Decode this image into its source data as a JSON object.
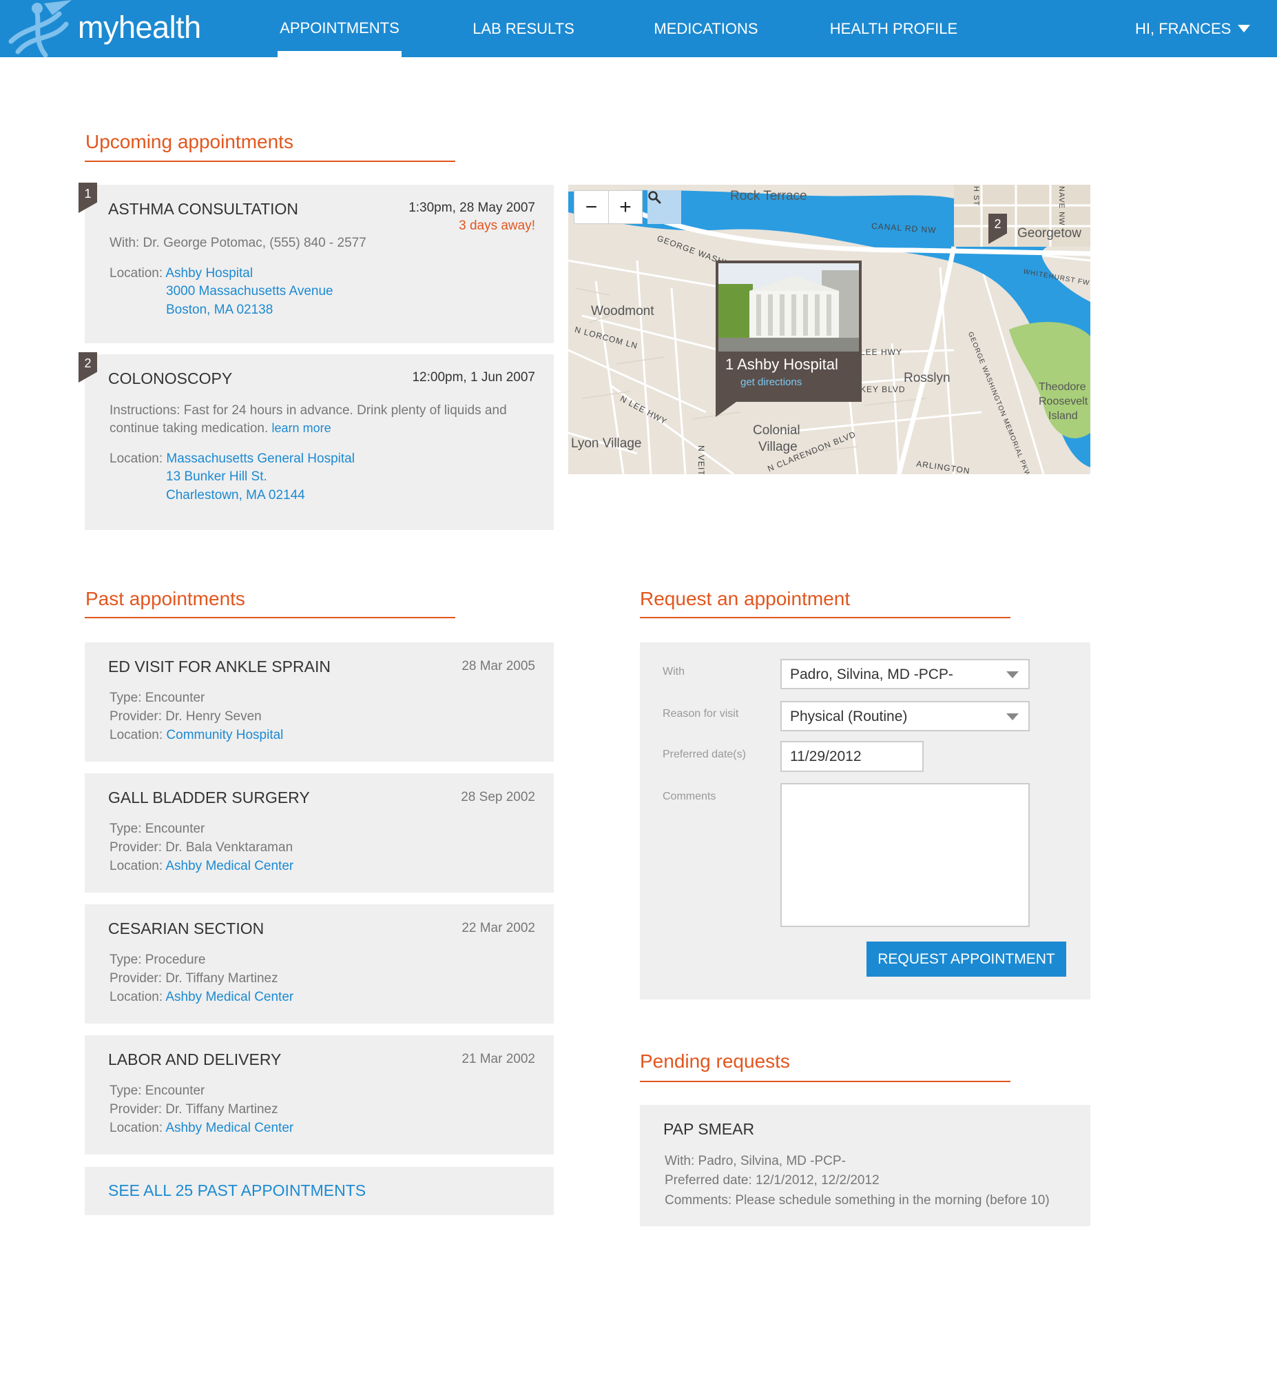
{
  "app": {
    "brand": "myhealth"
  },
  "nav": {
    "items": [
      {
        "label": "APPOINTMENTS",
        "active": true
      },
      {
        "label": "LAB RESULTS"
      },
      {
        "label": "MEDICATIONS"
      },
      {
        "label": "HEALTH PROFILE"
      }
    ],
    "user": "HI, FRANCES"
  },
  "colors": {
    "brand": "#1c8ad2",
    "accent": "#e2561e",
    "card": "#efefef",
    "flag": "#5a4f4a"
  },
  "upcoming": {
    "title": "Upcoming appointments",
    "items": [
      {
        "index": "1",
        "title": "ASTHMA CONSULTATION",
        "time": "1:30pm, 28 May 2007",
        "countdown": "3 days away!",
        "with": "With: Dr. George Potomac, (555) 840 - 2577",
        "location_label": "Location:",
        "location_name": "Ashby Hospital",
        "address1": "3000 Massachusetts Avenue",
        "address2": "Boston, MA 02138"
      },
      {
        "index": "2",
        "title": "COLONOSCOPY",
        "time": "12:00pm, 1 Jun 2007",
        "instructions1": "Instructions: Fast for 24 hours in advance. Drink plenty of liquids and",
        "instructions2": "continue taking medication.",
        "learn_more": "learn more",
        "location_label": "Location:",
        "location_name": "Massachusetts General Hospital",
        "address1": "13 Bunker Hill St.",
        "address2": "Charlestown, MA 02144"
      }
    ]
  },
  "map": {
    "zoom_out": "−",
    "zoom_in": "+",
    "search_icon": "magnifier-icon",
    "labels": {
      "rock_terrace": "Rock Terrace",
      "georgetown": "Georgetow",
      "woodmont": "Woodmont",
      "rosslyn": "Rosslyn",
      "colonial1": "Colonial",
      "colonial2": "Village",
      "lyon_village": "Lyon Village",
      "roosevelt1": "Theodore",
      "roosevelt2": "Roosevelt",
      "roosevelt3": "Island"
    },
    "streets": {
      "canal": "CANAL RD NW",
      "gw": "GEORGE WASHIN",
      "lorcom": "N LORCOM LN",
      "lee_hwy": "N LEE HWY",
      "lee_hwy2": "LEE HWY",
      "key_blvd": "KEY BLVD",
      "veitch": "N VEITCH ST",
      "clarendon": "N CLARENDON BLVD",
      "arlington": "ARLINGTON",
      "whitehurst": "WHITEHURST FWY",
      "h_st": "H ST",
      "ave_nw": "NAVE NW",
      "gw_memorial": "GEORGE WASHINGTON MEMORIAL PKWY"
    },
    "popup": {
      "title": "1  Ashby Hospital",
      "link": "get directions"
    },
    "pin2": "2"
  },
  "past": {
    "title": "Past appointments",
    "items": [
      {
        "title": "ED VISIT FOR ANKLE SPRAIN",
        "date": "28 Mar 2005",
        "type": "Type: Encounter",
        "provider": "Provider: Dr. Henry Seven",
        "location_label": "Location:",
        "location_name": "Community Hospital"
      },
      {
        "title": "GALL BLADDER SURGERY",
        "date": "28 Sep 2002",
        "type": "Type: Encounter",
        "provider": "Provider: Dr. Bala Venktaraman",
        "location_label": "Location:",
        "location_name": "Ashby Medical Center"
      },
      {
        "title": "CESARIAN SECTION",
        "date": "22 Mar 2002",
        "type": "Type: Procedure",
        "provider": "Provider: Dr. Tiffany Martinez",
        "location_label": "Location:",
        "location_name": "Ashby Medical Center"
      },
      {
        "title": "LABOR AND DELIVERY",
        "date": "21 Mar 2002",
        "type": "Type: Encounter",
        "provider": "Provider: Dr. Tiffany Martinez",
        "location_label": "Location:",
        "location_name": "Ashby Medical Center"
      }
    ],
    "see_all": "SEE ALL 25 PAST APPOINTMENTS"
  },
  "request": {
    "title": "Request an appointment",
    "with_label": "With",
    "with_value": "Padro, Silvina, MD -PCP-",
    "reason_label": "Reason for visit",
    "reason_value": "Physical (Routine)",
    "date_label": "Preferred date(s)",
    "date_value": "11/29/2012",
    "comments_label": "Comments",
    "submit": "REQUEST APPOINTMENT"
  },
  "pending": {
    "title": "Pending requests",
    "item_title": "PAP SMEAR",
    "with": "With: Padro, Silvina, MD -PCP-",
    "preferred": "Preferred date: 12/1/2012, 12/2/2012",
    "comments": "Comments: Please schedule something in the morning (before 10)"
  }
}
